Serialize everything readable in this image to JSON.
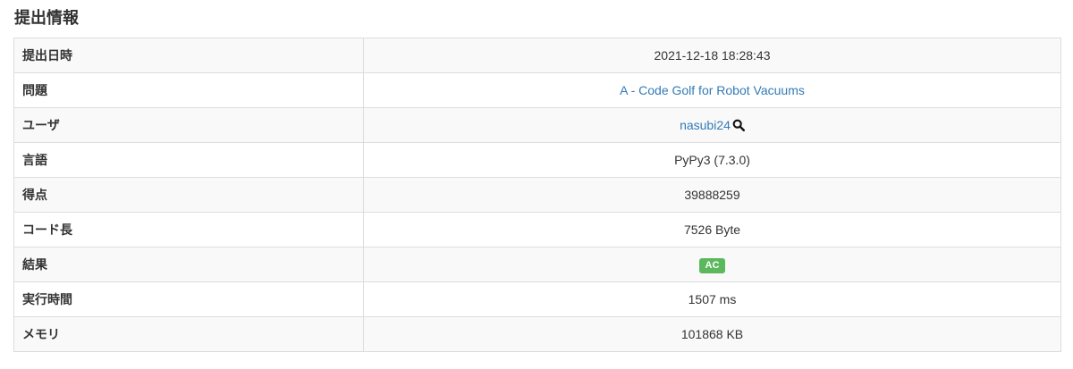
{
  "page": {
    "title": "提出情報"
  },
  "submission": {
    "rows": {
      "submitted_at": {
        "label": "提出日時",
        "value": "2021-12-18 18:28:43"
      },
      "problem": {
        "label": "問題",
        "value": "A - Code Golf for Robot Vacuums"
      },
      "user": {
        "label": "ユーザ",
        "value": "nasubi24",
        "icon": "search-icon"
      },
      "language": {
        "label": "言語",
        "value": "PyPy3 (7.3.0)"
      },
      "score": {
        "label": "得点",
        "value": "39888259"
      },
      "code_length": {
        "label": "コード長",
        "value": "7526 Byte"
      },
      "result": {
        "label": "結果",
        "value": "AC",
        "status_color": "#5cb85c"
      },
      "exec_time": {
        "label": "実行時間",
        "value": "1507 ms"
      },
      "memory": {
        "label": "メモリ",
        "value": "101868 KB"
      }
    }
  },
  "colors": {
    "link": "#337ab7",
    "border": "#dddddd",
    "stripe": "#f9f9f9",
    "text": "#333333"
  }
}
